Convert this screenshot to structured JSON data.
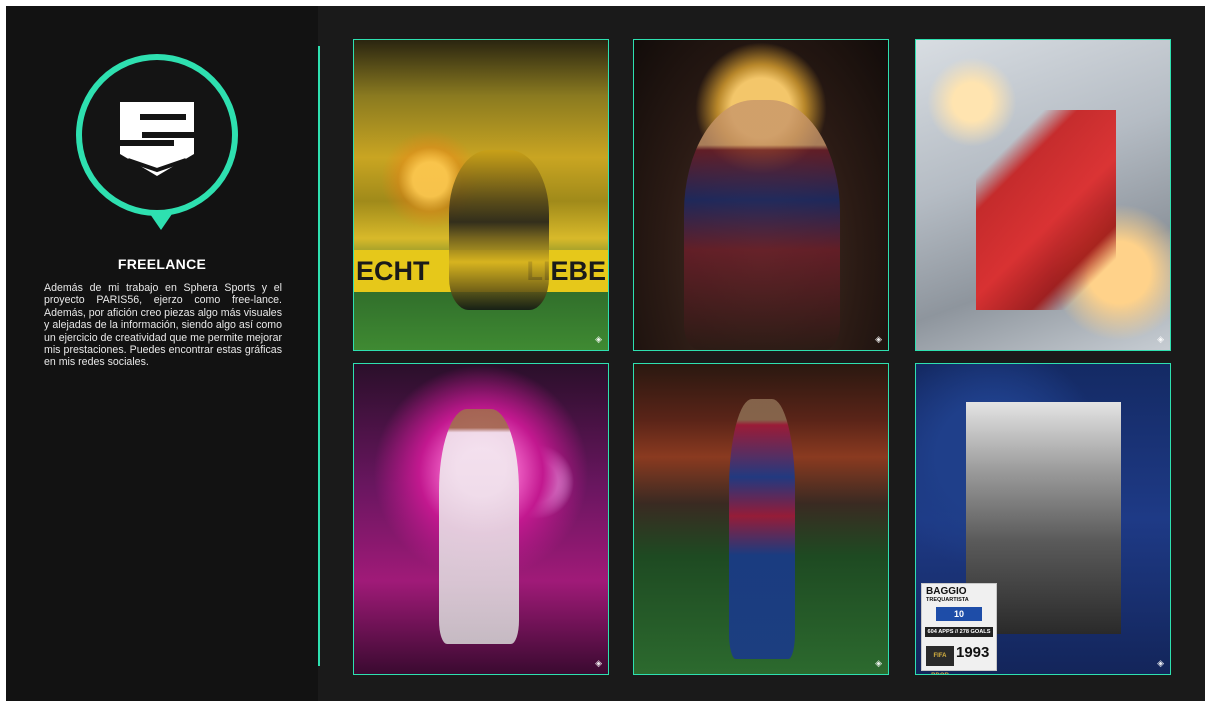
{
  "section": {
    "title": "FREELANCE",
    "description": "Además de mi trabajo en Sphera Sports y el proyecto PARIS56, ejerzo como free-lance. Además, por afición creo piezas algo más visuales y alejadas de la información, siendo algo así como un ejercicio de creatividad que me permite mejorar mis prestaciones. Puedes encontrar estas gráficas en mis redes sociales."
  },
  "colors": {
    "accent": "#2ee0b0",
    "background": "#1a1a1a"
  },
  "gallery": {
    "card1": {
      "banner_left": "ECHT",
      "banner_right": "LIEBE"
    },
    "card6": {
      "name": "BAGGIO",
      "role": "TREQUARTISTA",
      "number": "10",
      "stats": "604 APPS // 278 GOALS",
      "badge": "FIFA BDOR",
      "year": "1993"
    },
    "corner_mark": "◈"
  }
}
